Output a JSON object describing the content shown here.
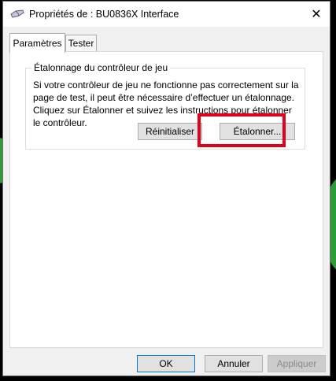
{
  "window": {
    "title": "Propriétés de : BU0836X Interface",
    "close_glyph": "✕"
  },
  "tabs": [
    {
      "label": "Paramètres",
      "active": true
    },
    {
      "label": "Tester",
      "active": false
    }
  ],
  "calibration_group": {
    "title": "Étalonnage du contrôleur de jeu",
    "description": "Si votre contrôleur de jeu ne fonctionne pas correctement sur la page de test, il peut être nécessaire d’effectuer un étalonnage. Cliquez sur Étalonner et suivez les instructions pour étalonner le contrôleur.",
    "reset_label": "Réinitialiser",
    "calibrate_label": "Étalonner..."
  },
  "footer": {
    "ok_label": "OK",
    "cancel_label": "Annuler",
    "apply_label": "Appliquer"
  },
  "colors": {
    "highlight": "#e2001a",
    "background_green": "#2f9a3a",
    "focus_border": "#0078d7"
  },
  "icons": {
    "title_icon": "joystick-icon",
    "close_icon": "close-icon"
  }
}
